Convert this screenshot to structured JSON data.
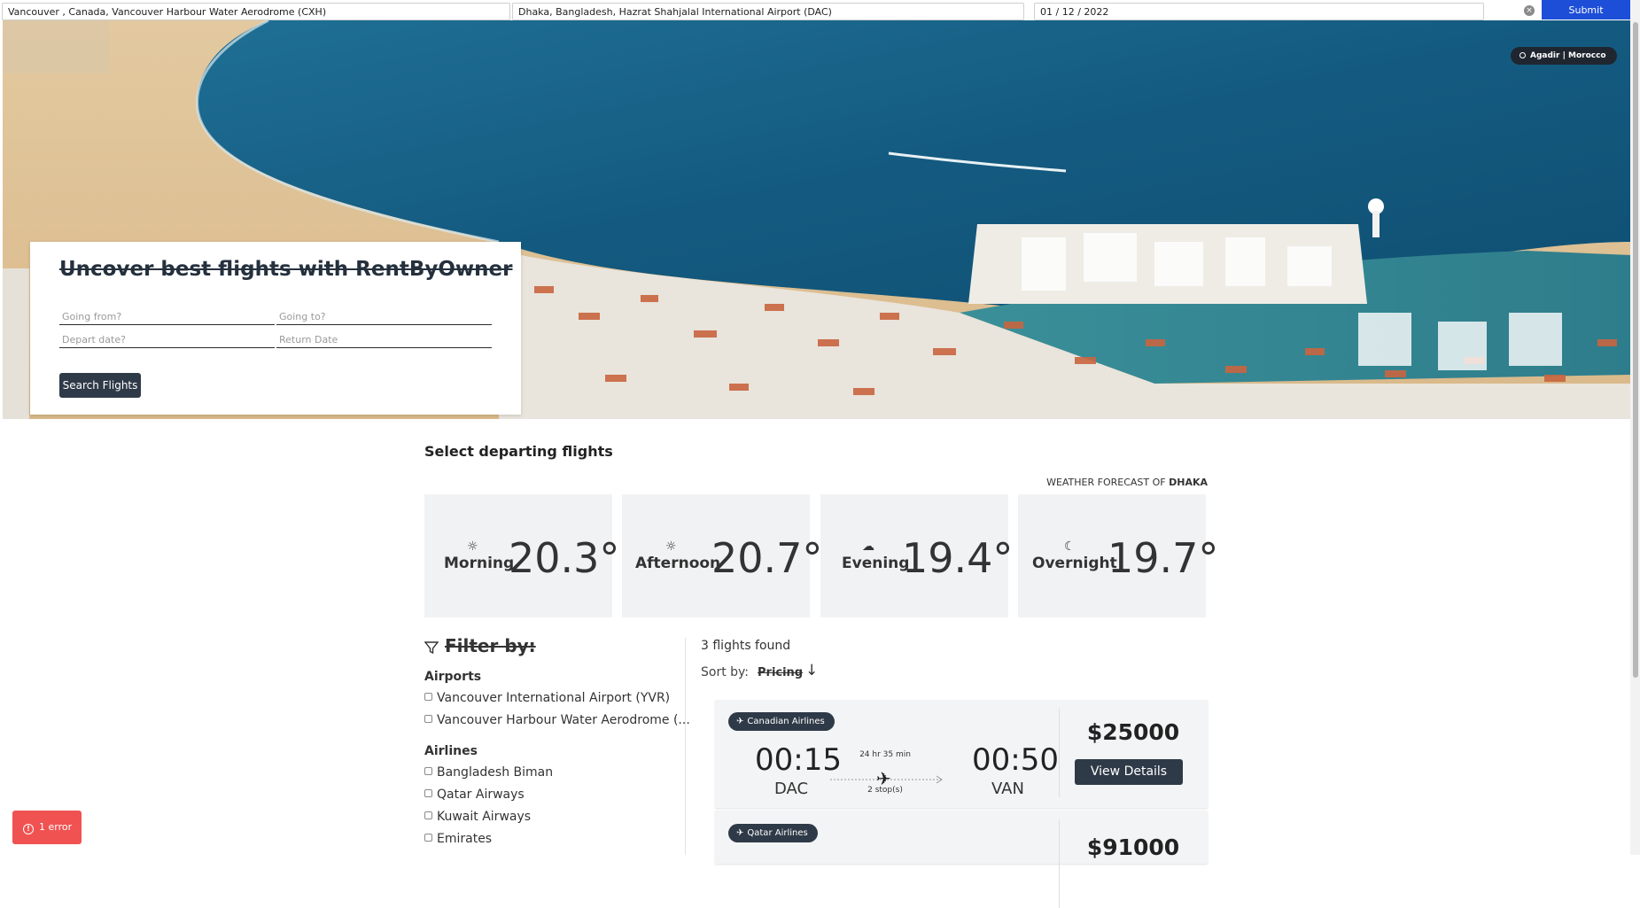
{
  "topbar": {
    "from_value": "Vancouver , Canada, Vancouver Harbour Water Aerodrome (CXH)",
    "to_value": "Dhaka, Bangladesh, Hazrat Shahjalal International Airport (DAC)",
    "date_value": "01 / 12 / 2022",
    "submit_label": "Submit"
  },
  "hero": {
    "location": "Agadir | Morocco",
    "search_title": "Uncover best flights with RentByOwner",
    "going_from_placeholder": "Going from?",
    "going_to_placeholder": "Going to?",
    "depart_placeholder": "Depart date?",
    "return_placeholder": "Return Date",
    "search_button": "Search Flights"
  },
  "main": {
    "section_title": "Select departing flights",
    "weather_caption_prefix": "WEATHER FORECAST OF",
    "weather_city": "DHAKA",
    "weather": [
      {
        "icon": "sun-icon",
        "label": "Morning",
        "temp": "20.3°"
      },
      {
        "icon": "sun-icon",
        "label": "Afternoon",
        "temp": "20.7°"
      },
      {
        "icon": "cloud-icon",
        "label": "Evening",
        "temp": "19.4°"
      },
      {
        "icon": "moon-icon",
        "label": "Overnight",
        "temp": "19.7°"
      }
    ]
  },
  "filter": {
    "title": "Filter by:",
    "airports_heading": "Airports",
    "airports": [
      "Vancouver International Airport (YVR)",
      "Vancouver Harbour Water Aerodrome (..."
    ],
    "airlines_heading": "Airlines",
    "airlines": [
      "Bangladesh Biman",
      "Qatar Airways",
      "Kuwait Airways",
      "Emirates"
    ]
  },
  "results": {
    "count_text": "3 flights found",
    "sort_label": "Sort by:",
    "sort_value": "Pricing",
    "flights": [
      {
        "airline": "Canadian Airlines",
        "dep_time": "00:15",
        "dep_code": "DAC",
        "duration": "24 hr 35 min",
        "stops": "2 stop(s)",
        "arr_time": "00:50",
        "arr_code": "VAN",
        "price": "$25000",
        "details_label": "View Details"
      },
      {
        "airline": "Qatar Airlines",
        "price": "$91000"
      }
    ]
  },
  "error": {
    "label": "1 error"
  },
  "colors": {
    "primary_dark": "#2f3a48",
    "submit_blue": "#1d4ed8",
    "error_red": "#f05252"
  }
}
